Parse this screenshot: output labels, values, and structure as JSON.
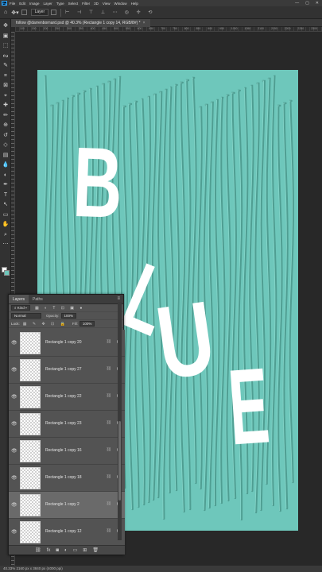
{
  "app": {
    "logo": "Ps"
  },
  "menu": [
    "File",
    "Edit",
    "Image",
    "Layer",
    "Type",
    "Select",
    "Filter",
    "3D",
    "View",
    "Window",
    "Help"
  ],
  "window_controls": [
    "—",
    "▢",
    "✕"
  ],
  "options_bar": {
    "auto_select_value": "Layer"
  },
  "document": {
    "tab_title": "follow @darrenbornard.psd @ 40.3% (Rectangle 1 copy 14, RGB/8#) *",
    "close": "×"
  },
  "ruler": {
    "labels": [
      "100",
      "150",
      "200",
      "250",
      "300",
      "350",
      "400",
      "450",
      "500",
      "550",
      "600",
      "650",
      "700",
      "750",
      "800",
      "850",
      "900",
      "950",
      "1000",
      "1050",
      "2100",
      "2150",
      "2200",
      "2250",
      "2300"
    ]
  },
  "artwork": {
    "background_color": "#6ec7bb",
    "line_color": "#4f9e92",
    "letter_color": "#ffffff",
    "letters": [
      "B",
      "L",
      "U",
      "E"
    ]
  },
  "status": {
    "text": "40.33%  2160 px x 3840 px (4000 ppi)"
  },
  "layers_panel": {
    "tabs": [
      "Layers",
      "Paths"
    ],
    "menu_icon": "≡",
    "filter_kind": "Kind",
    "blend_mode": "Normal",
    "opacity_label": "Opacity:",
    "opacity_value": "100%",
    "lock_label": "Lock:",
    "fill_label": "Fill:",
    "fill_value": "100%",
    "layers": [
      {
        "name": "Rectangle 1 copy 20",
        "fx": "fx",
        "selected": false
      },
      {
        "name": "Rectangle 1 copy 27",
        "fx": "fx",
        "selected": false
      },
      {
        "name": "Rectangle 1 copy 22",
        "fx": "fx",
        "selected": false
      },
      {
        "name": "Rectangle 1 copy 23",
        "fx": "fx",
        "selected": false
      },
      {
        "name": "Rectangle 1 copy 16",
        "fx": "fx",
        "selected": false
      },
      {
        "name": "Rectangle 1 copy 18",
        "fx": "fx",
        "selected": false
      },
      {
        "name": "Rectangle 1 copy 2",
        "fx": "fx",
        "selected": true
      },
      {
        "name": "Rectangle 1 copy 12",
        "fx": "fx",
        "selected": false
      }
    ],
    "footer_icons": [
      "link-icon",
      "fx-icon",
      "mask-icon",
      "adjustment-icon",
      "folder-icon",
      "new-layer-icon",
      "trash-icon"
    ],
    "footer_glyphs": [
      "⛓",
      "fx",
      "◙",
      "◐",
      "▭",
      "⊞",
      "🗑"
    ]
  },
  "tools": [
    "move-tool-icon",
    "artboard-tool-icon",
    "marquee-tool-icon",
    "lasso-tool-icon",
    "quick-select-tool-icon",
    "crop-tool-icon",
    "frame-tool-icon",
    "eyedropper-tool-icon",
    "healing-tool-icon",
    "brush-tool-icon",
    "stamp-tool-icon",
    "history-brush-tool-icon",
    "eraser-tool-icon",
    "gradient-tool-icon",
    "blur-tool-icon",
    "dodge-tool-icon",
    "pen-tool-icon",
    "type-tool-icon",
    "path-select-tool-icon",
    "shape-tool-icon",
    "hand-tool-icon",
    "zoom-tool-icon",
    "more-tools-icon"
  ],
  "tool_glyphs": [
    "✥",
    "▣",
    "⬚",
    "ᔓ",
    "✎",
    "⌗",
    "⊠",
    "⌖",
    "✚",
    "✏",
    "⊕",
    "↺",
    "◇",
    "▤",
    "💧",
    "◐",
    "✒",
    "T",
    "↖",
    "▭",
    "✋",
    "⌕",
    "⋯"
  ]
}
